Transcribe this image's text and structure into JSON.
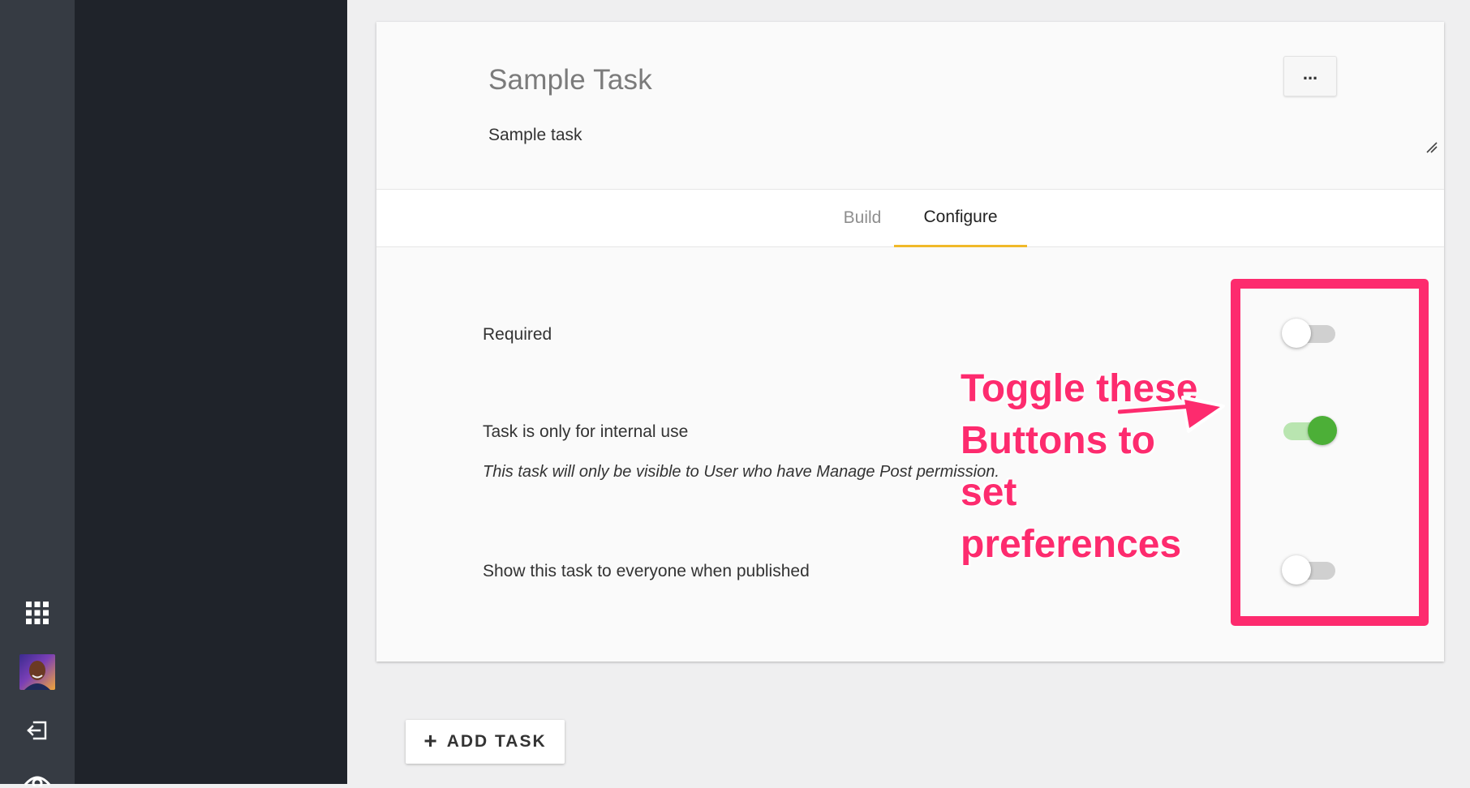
{
  "task": {
    "title": "Sample Task",
    "description": "Sample task",
    "menu_label": "..."
  },
  "tabs": [
    {
      "label": "Build",
      "active": false
    },
    {
      "label": "Configure",
      "active": true
    }
  ],
  "settings": [
    {
      "label": "Required",
      "note": "",
      "enabled": false
    },
    {
      "label": "Task is only for internal use",
      "note": "This task will only be visible to User who have Manage Post permission.",
      "enabled": true
    },
    {
      "label": "Show this task to everyone when published",
      "note": "",
      "enabled": false
    }
  ],
  "annotation": {
    "text": "Toggle these\nButtons to\nset\npreferences",
    "color": "#fd2b6e"
  },
  "add_task": {
    "icon": "plus-icon",
    "label": "ADD TASK"
  },
  "sidebar": {
    "icons": [
      "apps-grid-icon",
      "user-avatar",
      "logout-icon",
      "eye-icon"
    ]
  },
  "colors": {
    "toggle_on": "#4caf37",
    "tab_underline": "#f0b929",
    "nav_background": "#1f232a"
  }
}
